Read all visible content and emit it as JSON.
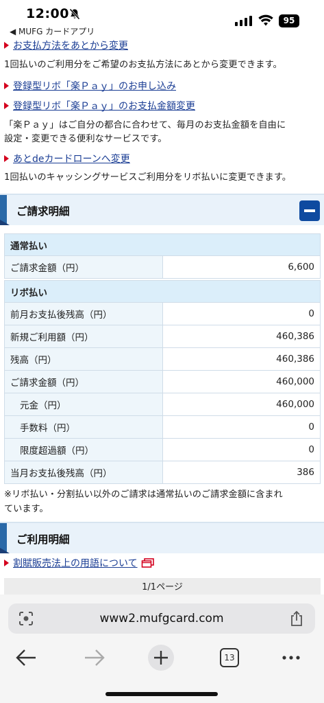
{
  "status": {
    "time": "12:00",
    "back_app": "◀ MUFG カードアプリ",
    "battery": "95"
  },
  "links": {
    "pay_later": "お支払方法をあとから変更",
    "revo_apply": "登録型リボ「楽Ｐａｙ」のお申し込み",
    "revo_change": "登録型リボ「楽Ｐａｙ」のお支払金額変更",
    "loan_change": "あとdeカードローンへ変更",
    "terms": "割賦販売法上の用語について"
  },
  "descs": {
    "pay_later": "1回払いのご利用分をご希望のお支払方法にあとから変更できます。",
    "revo_line1": "「楽Ｐａｙ」はご自分の都合に合わせて、毎月のお支払金額を自由に",
    "revo_line2": "設定・変更できる便利なサービスです。",
    "loan": "1回払いのキャッシングサービスご利用分をリボ払いに変更できます。"
  },
  "billing": {
    "title": "ご請求明細",
    "normal_head": "通常払い",
    "normal_rows": [
      {
        "label": "ご請求金額（円）",
        "value": "6,600"
      }
    ],
    "revo_head": "リボ払い",
    "revo_rows": [
      {
        "label": "前月お支払後残高（円）",
        "value": "0"
      },
      {
        "label": "新規ご利用額（円）",
        "value": "460,386"
      },
      {
        "label": "残高（円）",
        "value": "460,386"
      },
      {
        "label": "ご請求金額（円）",
        "value": "460,000"
      },
      {
        "label": "元金（円）",
        "value": "460,000"
      },
      {
        "label": "手数料（円）",
        "value": "0"
      },
      {
        "label": "限度超過額（円）",
        "value": "0"
      },
      {
        "label": "当月お支払後残高（円）",
        "value": "386"
      }
    ],
    "note_line1": "※リボ払い・分割払い以外のご請求は通常払いのご請求金額に含まれ",
    "note_line2": "ています。"
  },
  "usage": {
    "title": "ご利用明細",
    "pager": "1/1ページ"
  },
  "browser": {
    "url": "www2.mufgcard.com",
    "tabs_count": "13"
  },
  "colors": {
    "link": "#1a3d94",
    "accent_red": "#d4001e",
    "header_blue": "#2a69a8",
    "toggle_blue": "#0e4aa0"
  }
}
